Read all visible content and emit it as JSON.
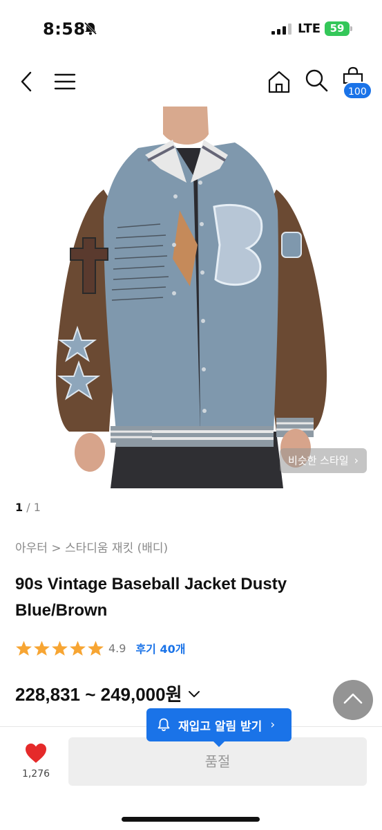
{
  "status_bar": {
    "time": "8:58",
    "network": "LTE",
    "battery": "59"
  },
  "nav": {
    "cart_count": "100"
  },
  "image": {
    "similar_style_label": "비슷한 스타일",
    "pager_current": "1",
    "pager_separator": " / ",
    "pager_total": "1"
  },
  "product": {
    "breadcrumb": "아우터 > 스타디움 재킷 (배디)",
    "title": "90s Vintage Baseball Jacket Dusty Blue/Brown",
    "rating_score": "4.9",
    "rating_stars": 5,
    "reviews_label": "후기 40개",
    "price": "228,831 ~ 249,000원"
  },
  "restock_tooltip": {
    "label": "재입고 알림 받기",
    "chevron": "›"
  },
  "bottom_bar": {
    "wish_count": "1,276",
    "soldout_label": "품절"
  },
  "colors": {
    "accent_blue": "#1a73e8",
    "star": "#f7a533",
    "heart": "#e52a2a",
    "battery": "#34c759"
  }
}
